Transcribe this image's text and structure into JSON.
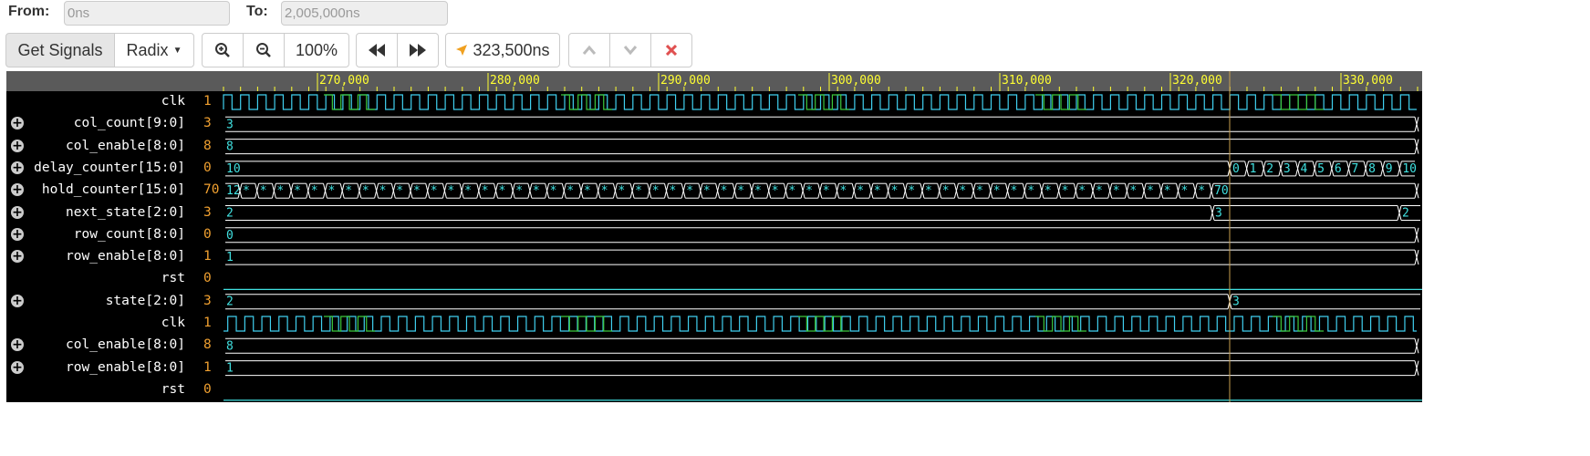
{
  "range": {
    "from_label": "From:",
    "from_value": "0ns",
    "to_label": "To:",
    "to_value": "2,005,000ns"
  },
  "toolbar": {
    "get_signals": "Get Signals",
    "radix": "Radix",
    "zoom": "100%",
    "cursor_time": "323,500ns"
  },
  "ruler": {
    "ticks": [
      "270,000",
      "280,000",
      "290,000",
      "300,000",
      "310,000",
      "320,000",
      "330,000"
    ]
  },
  "signals": [
    {
      "name": "clk",
      "value": "1",
      "expandable": false,
      "type": "clock",
      "phase": 0
    },
    {
      "name": "col_count[9:0]",
      "value": "3",
      "expandable": true,
      "type": "bus",
      "values": [
        "3"
      ]
    },
    {
      "name": "col_enable[8:0]",
      "value": "8",
      "expandable": true,
      "type": "bus",
      "values": [
        "8"
      ]
    },
    {
      "name": "delay_counter[15:0]",
      "value": "0",
      "expandable": true,
      "type": "bus",
      "values": [
        "10",
        "0",
        "1",
        "2",
        "3",
        "4",
        "5",
        "6",
        "7",
        "8",
        "9",
        "10"
      ]
    },
    {
      "name": "hold_counter[15:0]",
      "value": "70",
      "expandable": true,
      "type": "bus",
      "values": [
        "12",
        "*",
        "70"
      ]
    },
    {
      "name": "next_state[2:0]",
      "value": "3",
      "expandable": true,
      "type": "bus",
      "values": [
        "2",
        "3",
        "2"
      ]
    },
    {
      "name": "row_count[8:0]",
      "value": "0",
      "expandable": true,
      "type": "bus",
      "values": [
        "0"
      ]
    },
    {
      "name": "row_enable[8:0]",
      "value": "1",
      "expandable": true,
      "type": "bus",
      "values": [
        "1"
      ]
    },
    {
      "name": "rst",
      "value": "0",
      "expandable": false,
      "type": "bit",
      "level": 0
    },
    {
      "name": "state[2:0]",
      "value": "3",
      "expandable": true,
      "type": "bus",
      "values": [
        "2",
        "3"
      ]
    },
    {
      "name": "clk",
      "value": "1",
      "expandable": false,
      "type": "clock",
      "phase": 1
    },
    {
      "name": "col_enable[8:0]",
      "value": "8",
      "expandable": true,
      "type": "bus",
      "values": [
        "8"
      ]
    },
    {
      "name": "row_enable[8:0]",
      "value": "1",
      "expandable": true,
      "type": "bus",
      "values": [
        "1"
      ]
    },
    {
      "name": "rst",
      "value": "0",
      "expandable": false,
      "type": "bit",
      "level": 0
    }
  ],
  "colors": {
    "wave_bus": "#ffffff",
    "wave_text": "#40e0e0",
    "clock_a": "#40d0f0",
    "clock_b": "#3cc83c",
    "cursor": "#c8a050",
    "ruler_text": "#ffff33",
    "value_text": "#f0a030"
  }
}
